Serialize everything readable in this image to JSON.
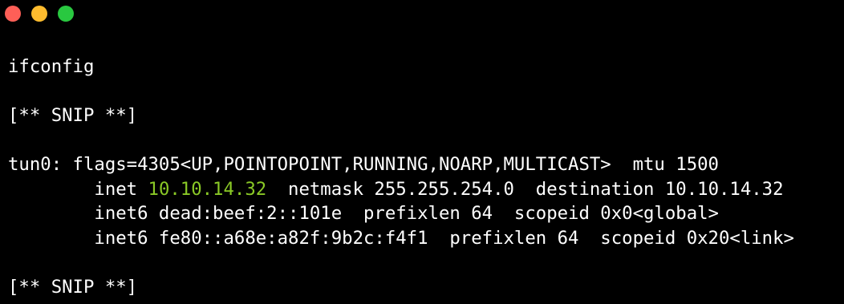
{
  "window": {
    "controls": [
      {
        "name": "close",
        "color": "#fe5f57"
      },
      {
        "name": "minimize",
        "color": "#febc2e"
      },
      {
        "name": "zoom",
        "color": "#29c840"
      }
    ]
  },
  "terminal": {
    "highlight_color": "#8ac926",
    "text_color": "#ffffff",
    "background": "#000000",
    "command": "ifconfig",
    "snip_top": "[** SNIP **]",
    "tun0_header": "tun0: flags=4305<UP,POINTOPOINT,RUNNING,NOARP,MULTICAST>  mtu 1500",
    "inet_prefix": "        inet ",
    "inet_addr": "10.10.14.32",
    "inet_suffix": "  netmask 255.255.254.0  destination 10.10.14.32",
    "inet6_global": "        inet6 dead:beef:2::101e  prefixlen 64  scopeid 0x0<global>",
    "inet6_link": "        inet6 fe80::a68e:a82f:9b2c:f4f1  prefixlen 64  scopeid 0x20<link>",
    "snip_bottom": "[** SNIP **]"
  }
}
